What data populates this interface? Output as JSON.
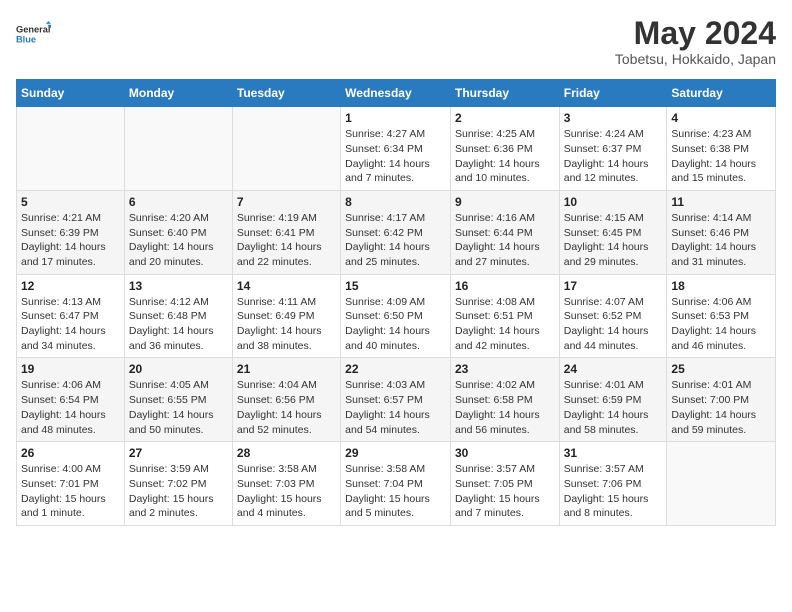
{
  "logo": {
    "line1": "General",
    "line2": "Blue"
  },
  "title": "May 2024",
  "location": "Tobetsu, Hokkaido, Japan",
  "days_of_week": [
    "Sunday",
    "Monday",
    "Tuesday",
    "Wednesday",
    "Thursday",
    "Friday",
    "Saturday"
  ],
  "weeks": [
    {
      "cells": [
        {
          "day": null
        },
        {
          "day": null
        },
        {
          "day": null
        },
        {
          "day": "1",
          "sunrise": "4:27 AM",
          "sunset": "6:34 PM",
          "daylight": "14 hours and 7 minutes."
        },
        {
          "day": "2",
          "sunrise": "4:25 AM",
          "sunset": "6:36 PM",
          "daylight": "14 hours and 10 minutes."
        },
        {
          "day": "3",
          "sunrise": "4:24 AM",
          "sunset": "6:37 PM",
          "daylight": "14 hours and 12 minutes."
        },
        {
          "day": "4",
          "sunrise": "4:23 AM",
          "sunset": "6:38 PM",
          "daylight": "14 hours and 15 minutes."
        }
      ]
    },
    {
      "cells": [
        {
          "day": "5",
          "sunrise": "4:21 AM",
          "sunset": "6:39 PM",
          "daylight": "14 hours and 17 minutes."
        },
        {
          "day": "6",
          "sunrise": "4:20 AM",
          "sunset": "6:40 PM",
          "daylight": "14 hours and 20 minutes."
        },
        {
          "day": "7",
          "sunrise": "4:19 AM",
          "sunset": "6:41 PM",
          "daylight": "14 hours and 22 minutes."
        },
        {
          "day": "8",
          "sunrise": "4:17 AM",
          "sunset": "6:42 PM",
          "daylight": "14 hours and 25 minutes."
        },
        {
          "day": "9",
          "sunrise": "4:16 AM",
          "sunset": "6:44 PM",
          "daylight": "14 hours and 27 minutes."
        },
        {
          "day": "10",
          "sunrise": "4:15 AM",
          "sunset": "6:45 PM",
          "daylight": "14 hours and 29 minutes."
        },
        {
          "day": "11",
          "sunrise": "4:14 AM",
          "sunset": "6:46 PM",
          "daylight": "14 hours and 31 minutes."
        }
      ]
    },
    {
      "cells": [
        {
          "day": "12",
          "sunrise": "4:13 AM",
          "sunset": "6:47 PM",
          "daylight": "14 hours and 34 minutes."
        },
        {
          "day": "13",
          "sunrise": "4:12 AM",
          "sunset": "6:48 PM",
          "daylight": "14 hours and 36 minutes."
        },
        {
          "day": "14",
          "sunrise": "4:11 AM",
          "sunset": "6:49 PM",
          "daylight": "14 hours and 38 minutes."
        },
        {
          "day": "15",
          "sunrise": "4:09 AM",
          "sunset": "6:50 PM",
          "daylight": "14 hours and 40 minutes."
        },
        {
          "day": "16",
          "sunrise": "4:08 AM",
          "sunset": "6:51 PM",
          "daylight": "14 hours and 42 minutes."
        },
        {
          "day": "17",
          "sunrise": "4:07 AM",
          "sunset": "6:52 PM",
          "daylight": "14 hours and 44 minutes."
        },
        {
          "day": "18",
          "sunrise": "4:06 AM",
          "sunset": "6:53 PM",
          "daylight": "14 hours and 46 minutes."
        }
      ]
    },
    {
      "cells": [
        {
          "day": "19",
          "sunrise": "4:06 AM",
          "sunset": "6:54 PM",
          "daylight": "14 hours and 48 minutes."
        },
        {
          "day": "20",
          "sunrise": "4:05 AM",
          "sunset": "6:55 PM",
          "daylight": "14 hours and 50 minutes."
        },
        {
          "day": "21",
          "sunrise": "4:04 AM",
          "sunset": "6:56 PM",
          "daylight": "14 hours and 52 minutes."
        },
        {
          "day": "22",
          "sunrise": "4:03 AM",
          "sunset": "6:57 PM",
          "daylight": "14 hours and 54 minutes."
        },
        {
          "day": "23",
          "sunrise": "4:02 AM",
          "sunset": "6:58 PM",
          "daylight": "14 hours and 56 minutes."
        },
        {
          "day": "24",
          "sunrise": "4:01 AM",
          "sunset": "6:59 PM",
          "daylight": "14 hours and 58 minutes."
        },
        {
          "day": "25",
          "sunrise": "4:01 AM",
          "sunset": "7:00 PM",
          "daylight": "14 hours and 59 minutes."
        }
      ]
    },
    {
      "cells": [
        {
          "day": "26",
          "sunrise": "4:00 AM",
          "sunset": "7:01 PM",
          "daylight": "15 hours and 1 minute."
        },
        {
          "day": "27",
          "sunrise": "3:59 AM",
          "sunset": "7:02 PM",
          "daylight": "15 hours and 2 minutes."
        },
        {
          "day": "28",
          "sunrise": "3:58 AM",
          "sunset": "7:03 PM",
          "daylight": "15 hours and 4 minutes."
        },
        {
          "day": "29",
          "sunrise": "3:58 AM",
          "sunset": "7:04 PM",
          "daylight": "15 hours and 5 minutes."
        },
        {
          "day": "30",
          "sunrise": "3:57 AM",
          "sunset": "7:05 PM",
          "daylight": "15 hours and 7 minutes."
        },
        {
          "day": "31",
          "sunrise": "3:57 AM",
          "sunset": "7:06 PM",
          "daylight": "15 hours and 8 minutes."
        },
        {
          "day": null
        }
      ]
    }
  ]
}
